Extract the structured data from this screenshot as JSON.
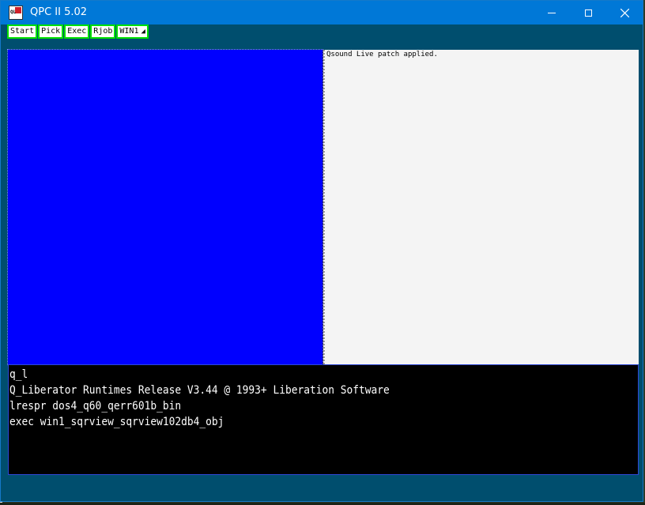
{
  "window": {
    "title": "QPC II 5.02",
    "icon_label": "QL"
  },
  "buttons": [
    {
      "label": "Start"
    },
    {
      "label": "Pick"
    },
    {
      "label": "Exec"
    },
    {
      "label": "Rjob"
    },
    {
      "label": "WIN1",
      "icon": "wedge-icon"
    }
  ],
  "panes": {
    "message": "Qsound Live patch applied."
  },
  "console": {
    "lines": [
      "q_l",
      "Q_Liberator Runtimes Release V3.44 @ 1993+ Liberation Software",
      "lrespr dos4_q60_qerr601b_bin",
      "exec win1_sqrview_sqrview102db4_obj"
    ]
  },
  "colors": {
    "titlebar": "#0078d7",
    "window_bg": "#004e6e",
    "button_border": "#00e000",
    "blue_pane": "#0000ff",
    "console_bg": "#000000"
  }
}
